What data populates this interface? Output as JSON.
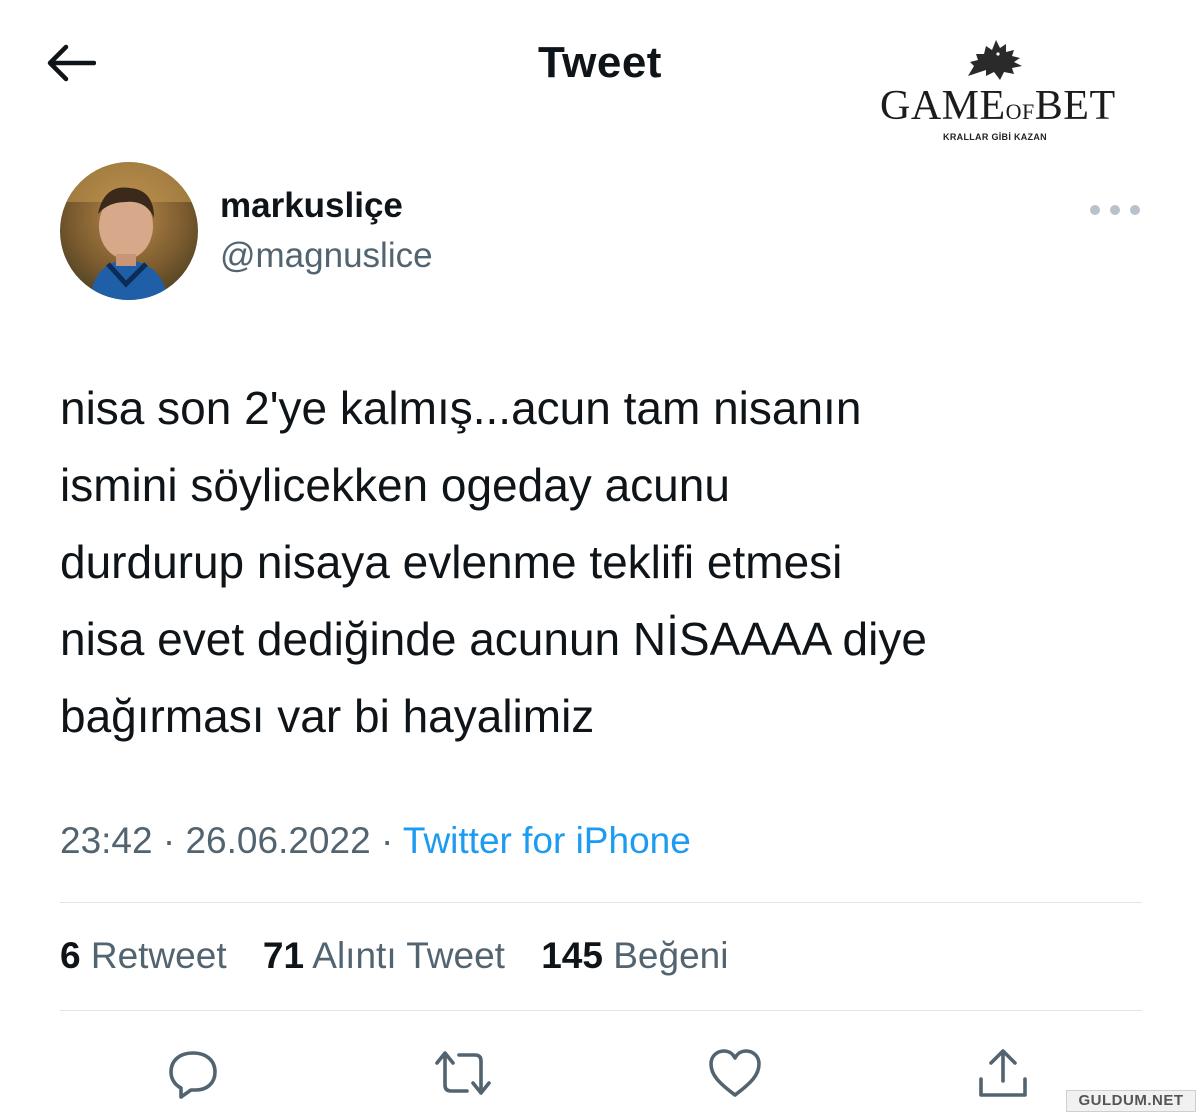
{
  "header": {
    "title": "Tweet"
  },
  "logo": {
    "text_main_1": "GAME",
    "text_of": "OF",
    "text_main_2": "BET",
    "tagline": "KRALLAR GİBİ KAZAN"
  },
  "tweet": {
    "display_name": "markusliçe",
    "handle": "@magnuslice",
    "text": "nisa son 2'ye kalmış...acun tam nisanın\nismini söylicekken ogeday acunu\ndurdurup nisaya evlenme teklifi etmesi\nnisa evet dediğinde acunun NİSAAAA diye\nbağırması var bi hayalimiz",
    "time": "23:42",
    "date": "26.06.2022",
    "separator": " · ",
    "source": "Twitter for iPhone"
  },
  "stats": {
    "retweets_count": "6",
    "retweets_label": "Retweet",
    "quotes_count": "71",
    "quotes_label": "Alıntı Tweet",
    "likes_count": "145",
    "likes_label": "Beğeni"
  },
  "watermark": {
    "text": "GULDUM.NET"
  },
  "icons": {
    "back": "arrow-left-icon",
    "more": "more-horizontal-icon",
    "reply": "reply-icon",
    "retweet": "retweet-icon",
    "like": "heart-icon",
    "share": "share-icon"
  },
  "colors": {
    "text": "#0f1419",
    "secondary": "#536471",
    "link": "#1d9bf0",
    "divider": "#e1e5e9"
  }
}
